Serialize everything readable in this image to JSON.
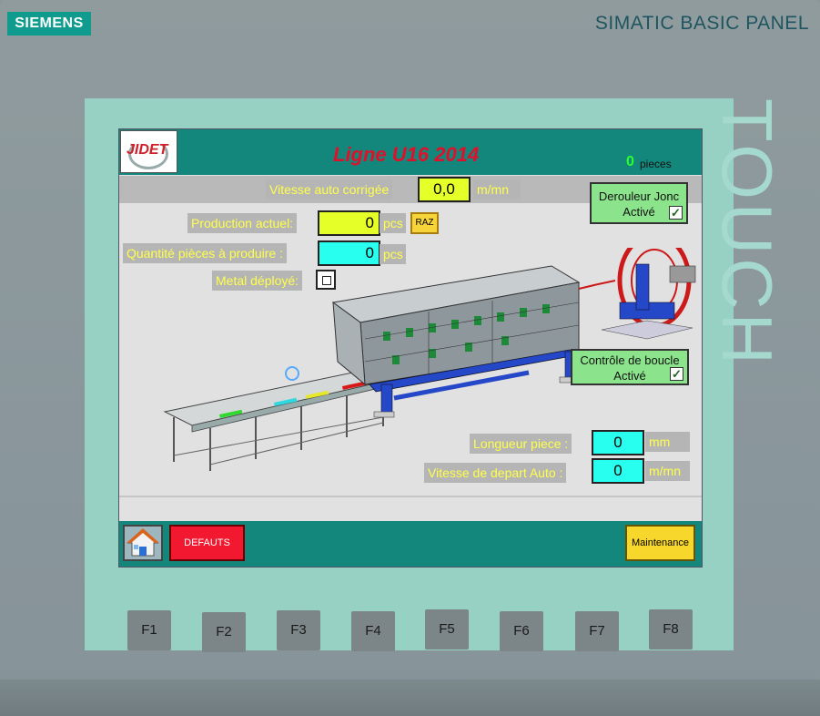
{
  "device": {
    "brand": "SIEMENS",
    "model": "SIMATIC BASIC PANEL",
    "touch_label": "TOUCH"
  },
  "header": {
    "logo_text": "JIDET",
    "title": "Ligne U16 2014",
    "piece_count": "0",
    "piece_unit": "pieces"
  },
  "speed_corrected": {
    "label": "Vitesse auto corrigée",
    "value": "0,0",
    "unit": "m/mn"
  },
  "production_actual": {
    "label": "Production actuel:",
    "value": "0",
    "unit": "pcs",
    "reset_label": "RAZ"
  },
  "quantity_to_produce": {
    "label": "Quantité pièces à produire :",
    "value": "0",
    "unit": "pcs"
  },
  "metal_deploye": {
    "label": "Metal déployé:"
  },
  "derouleur_jonc": {
    "line1": "Derouleur Jonc",
    "line2": "Activé",
    "check": "✓"
  },
  "controle_boucle": {
    "line1": "Contrôle de boucle",
    "line2": "Activé",
    "check": "✓"
  },
  "piece_length": {
    "label": "Longueur piece :",
    "value": "0",
    "unit": "mm"
  },
  "auto_start_speed": {
    "label": "Vitesse de depart Auto :",
    "value": "0",
    "unit": "m/mn"
  },
  "footer": {
    "defauts_label": "DEFAUTS",
    "maintenance_label": "Maintenance"
  },
  "function_keys": [
    "F1",
    "F2",
    "F3",
    "F4",
    "F5",
    "F6",
    "F7",
    "F8"
  ],
  "colors": {
    "accent": "#14877c",
    "bezel": "#97d1c4",
    "alarm": "#f21830",
    "warning": "#f7d72c",
    "input_yellow": "#e5ff29",
    "input_cyan": "#28ffee",
    "active_green": "#8be38b",
    "label_text": "#ffff4a"
  }
}
